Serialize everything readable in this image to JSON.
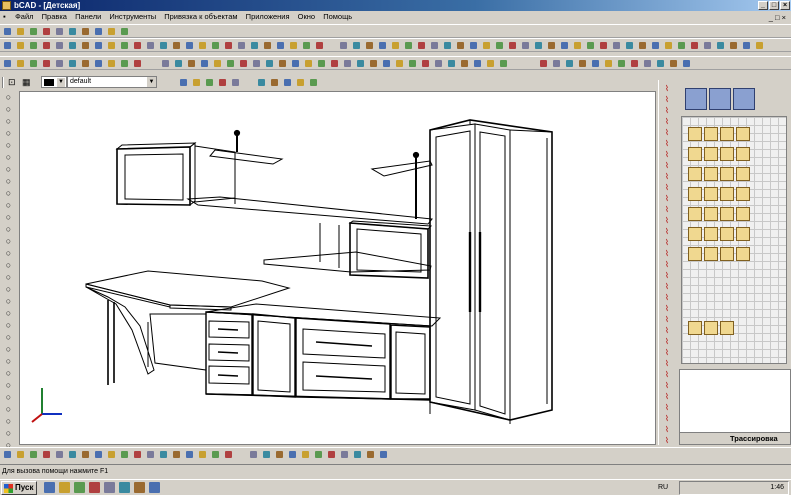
{
  "window": {
    "title": "bCAD - [Детская]"
  },
  "menu": [
    "Файл",
    "Правка",
    "Панели",
    "Инструменты",
    "Привязка к объектам",
    "Приложения",
    "Окно",
    "Помощь"
  ],
  "propbar": {
    "layer": "default"
  },
  "panel": {
    "tab_label": "Трассировка"
  },
  "statusbar": {
    "text": "Для вызова помощи нажмите F1"
  },
  "taskbar": {
    "start_label": "Пуск",
    "language": "RU",
    "clock": "1:46"
  },
  "icons": {
    "app": "bcad-app-icon",
    "minimize": "minimize-icon",
    "maximize": "maximize-icon",
    "close": "close-icon",
    "axes": "ucs-axes-icon"
  },
  "colors": {
    "title_bar": "#0a246a",
    "canvas": "#ffffff",
    "chrome": "#d4d0c8",
    "drawing_line": "#000000"
  }
}
